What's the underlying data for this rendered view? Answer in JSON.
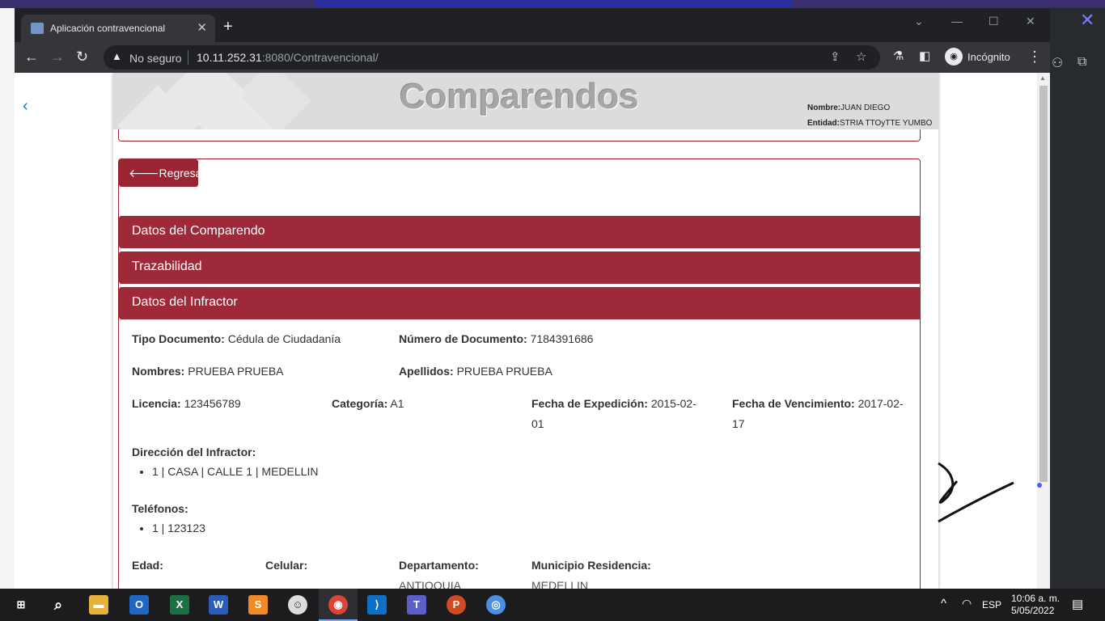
{
  "browser": {
    "tab_title": "Aplicación contravencional",
    "security_label": "No seguro",
    "url_host": "10.11.252.31",
    "url_rest": ":8080/Contravencional/",
    "profile_label": "Incógnito"
  },
  "header": {
    "title": "Comparendos",
    "nombre_label": "Nombre:",
    "nombre_value": "JUAN DIEGO",
    "entidad_label": "Entidad:",
    "entidad_value": "STRIA TTOyTTE YUMBO"
  },
  "actions": {
    "back_label": "Regresar"
  },
  "sections": [
    {
      "title": "Datos del Comparendo"
    },
    {
      "title": "Trazabilidad"
    },
    {
      "title": "Datos del Infractor"
    }
  ],
  "infractor": {
    "tipo_documento_label": "Tipo Documento:",
    "tipo_documento": "Cédula de Ciudadanía",
    "numero_documento_label": "Número de Documento:",
    "numero_documento": "7184391686",
    "nombres_label": "Nombres:",
    "nombres": "PRUEBA PRUEBA",
    "apellidos_label": "Apellidos:",
    "apellidos": "PRUEBA PRUEBA",
    "licencia_label": "Licencia:",
    "licencia": "123456789",
    "categoria_label": "Categoría:",
    "categoria": "A1",
    "fecha_expedicion_label": "Fecha de Expedición:",
    "fecha_expedicion": "2015-02-01",
    "fecha_vencimiento_label": "Fecha de Vencimiento:",
    "fecha_vencimiento": "2017-02-17",
    "direccion_label": "Dirección del Infractor:",
    "direcciones": [
      "1 | CASA | CALLE 1 | MEDELLIN"
    ],
    "telefonos_label": "Teléfonos:",
    "telefonos": [
      "1 | 123123"
    ],
    "edad_label": "Edad:",
    "celular_label": "Celular:",
    "departamento_label": "Departamento:",
    "departamento": "ANTIOQUIA",
    "municipio_label": "Municipio Residencia:",
    "municipio": "MEDELLIN"
  },
  "taskbar": {
    "language": "ESP",
    "time": "10:06 a. m.",
    "date": "5/05/2022"
  },
  "colors": {
    "brand": "#9e2939",
    "banner": "#dcdcdc"
  }
}
